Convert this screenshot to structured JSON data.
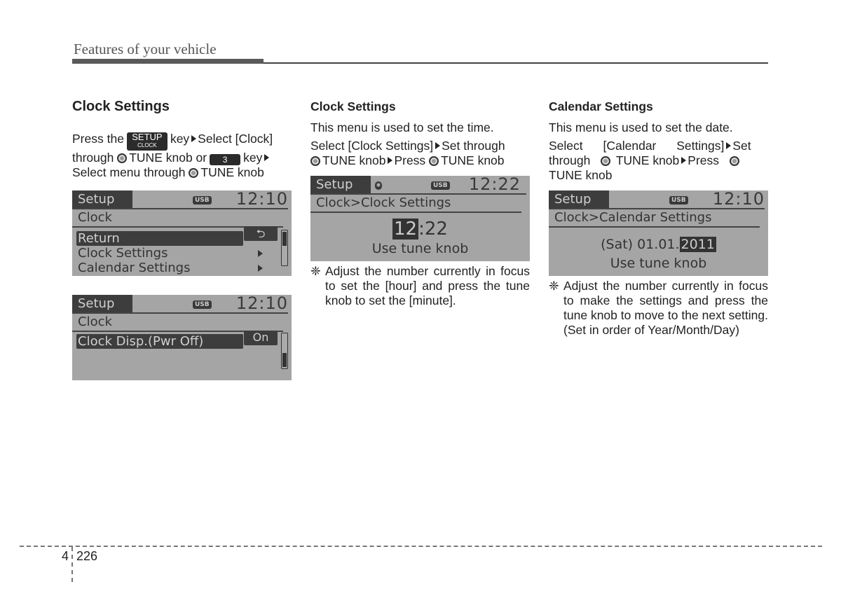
{
  "header": {
    "title": "Features of your vehicle"
  },
  "col1": {
    "heading": "Clock Settings",
    "line1_pre": "Press the",
    "setup_key_top": "SETUP",
    "setup_key_bottom": "CLOCK",
    "line1_post": "key",
    "line1_end": "Select [Clock]",
    "line2_pre": "through",
    "tune": "TUNE knob or",
    "num_key": "3",
    "line2_post": "key",
    "line3_pre": "Select menu through",
    "line3_post": "TUNE knob",
    "screen1": {
      "tab": "Setup",
      "usb": "USB",
      "time": "12:10",
      "title": "Clock",
      "items": [
        {
          "label": "Return",
          "action": "⮌",
          "selected": true
        },
        {
          "label": "Clock Settings",
          "selected": false
        },
        {
          "label": "Calendar Settings",
          "selected": false
        }
      ]
    },
    "screen2": {
      "tab": "Setup",
      "usb": "USB",
      "time": "12:10",
      "title": "Clock",
      "items": [
        {
          "label": "Clock Disp.(Pwr Off)",
          "value": "On",
          "selected": true
        }
      ]
    }
  },
  "col2": {
    "heading": "Clock Settings",
    "intro": "This menu is used to set the time.",
    "step_a": "Select [Clock Settings]",
    "step_b": "Set through",
    "step_c": "TUNE knob",
    "step_d": "Press",
    "step_e": "TUNE knob",
    "screen": {
      "tab": "Setup",
      "bt": "✱",
      "usb": "USB",
      "time": "12:22",
      "title": "Clock>Clock Settings",
      "hour": "12",
      "sep": ":",
      "minute": "22",
      "hint": "Use tune knob"
    },
    "note_mark": "❈",
    "note": "Adjust the number currently in focus to set the [hour] and press the tune knob to set the [minute]."
  },
  "col3": {
    "heading": "Calendar Settings",
    "intro": "This menu is used to set the date.",
    "step_a": "Select [Calendar Settings]",
    "step_b": "Set",
    "step_c": "through",
    "step_d": "TUNE knob",
    "step_e": "Press",
    "step_f": "TUNE knob",
    "screen": {
      "tab": "Setup",
      "usb": "USB",
      "time": "12:10",
      "title": "Clock>Calendar Settings",
      "date_prefix": "(Sat) 01.01.",
      "year": "2011",
      "hint": "Use tune knob"
    },
    "note_mark": "❈",
    "note": "Adjust the number currently in focus to make the settings and press the tune knob to move to the next setting. (Set in order of Year/Month/Day)"
  },
  "footer": {
    "chapter": "4",
    "page": "226"
  }
}
